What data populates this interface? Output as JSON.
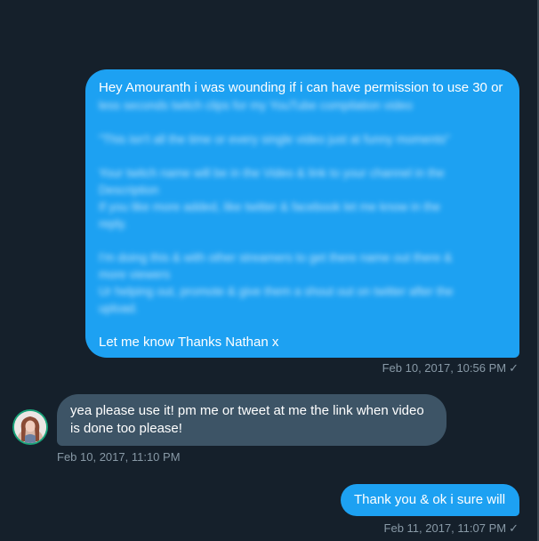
{
  "messages": [
    {
      "sender": "self",
      "first_line": "Hey Amouranth i was wounding if i can have permission to use 30 or",
      "blurred_lines": [
        "less seconds twitch clips for my YouTube compilation video",
        "",
        "\"This isn't all the time or every single video just at funny moments\"",
        "",
        "Your twitch name will be in the Video & link to your channel in the",
        "Description",
        "If you like more added, like twitter & facebook let me know in the",
        "reply.",
        "",
        "I'm doing this & with other streamers to get there name out there &",
        "more viewers",
        "Ur helping out, promote & give them a shout out on twitter after the",
        "upload.",
        ""
      ],
      "last_line": "Let me know Thanks Nathan x",
      "timestamp": "Feb 10, 2017, 10:56 PM",
      "status_icon": "✓"
    },
    {
      "sender": "other",
      "lines": [
        "yea please use it!  pm me or tweet at me the link when video",
        "is done too please!"
      ],
      "timestamp": "Feb 10, 2017, 11:10 PM"
    },
    {
      "sender": "self",
      "text": "Thank you & ok i sure will",
      "timestamp": "Feb 11, 2017, 11:07 PM",
      "status_icon": "✓"
    }
  ],
  "colors": {
    "background": "#15202b",
    "sent_bubble": "#1da1f2",
    "received_bubble": "#3d5466",
    "meta_text": "#8899a6",
    "avatar_ring": "#1aa37a"
  }
}
